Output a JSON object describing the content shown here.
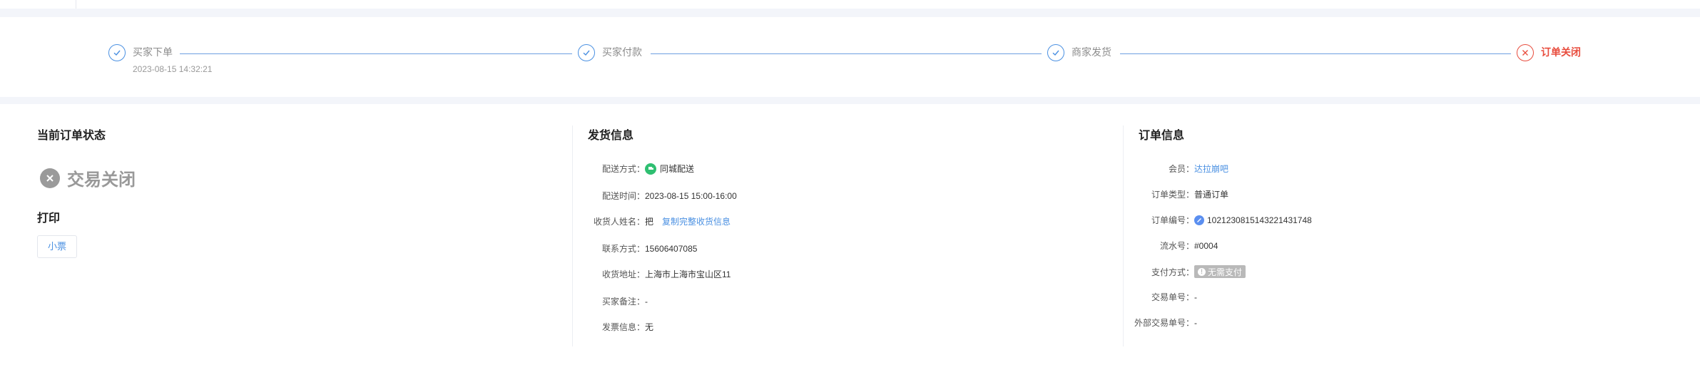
{
  "progress": {
    "steps": [
      {
        "label": "买家下单",
        "time": "2023-08-15 14:32:21",
        "state": "done"
      },
      {
        "label": "买家付款",
        "state": "done"
      },
      {
        "label": "商家发货",
        "state": "done"
      },
      {
        "label": "订单关闭",
        "state": "closed"
      }
    ],
    "colors": {
      "done": "#4a90e2",
      "closed": "#e84c3d"
    }
  },
  "status_section": {
    "title": "当前订单状态",
    "status": "交易关闭",
    "print_title": "打印",
    "receipt_button": "小票"
  },
  "shipping": {
    "title": "发货信息",
    "method_label": "配送方式：",
    "method_value": "同城配送",
    "time_label": "配送时间：",
    "time_value": "2023-08-15 15:00-16:00",
    "receiver_label": "收货人姓名：",
    "receiver_value": "把",
    "copy_link": "复制完整收货信息",
    "phone_label": "联系方式：",
    "phone_value": "15606407085",
    "address_label": "收货地址：",
    "address_value": "上海市上海市宝山区11",
    "remark_label": "买家备注：",
    "remark_value": "-",
    "invoice_label": "发票信息：",
    "invoice_value": "无"
  },
  "order": {
    "title": "订单信息",
    "member_label": "会员：",
    "member_value": "达拉崩吧",
    "type_label": "订单类型：",
    "type_value": "普通订单",
    "number_label": "订单编号：",
    "number_value": "102123081514322143174​8",
    "serial_label": "流水号：",
    "serial_value": "#0004",
    "payment_label": "支付方式：",
    "payment_value": "无需支付",
    "trade_no_label": "交易单号：",
    "trade_no_value": "-",
    "ext_trade_no_label": "外部交易单号：",
    "ext_trade_no_value": "-"
  }
}
